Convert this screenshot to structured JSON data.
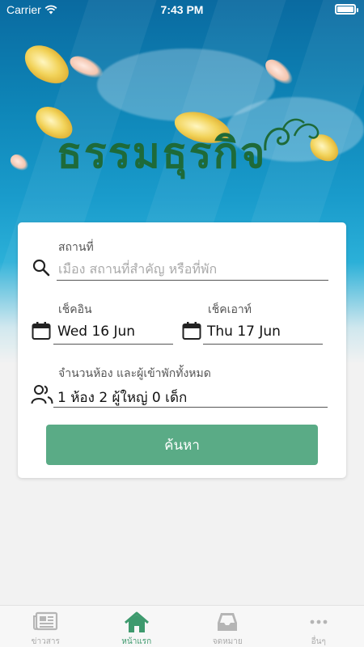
{
  "status": {
    "carrier": "Carrier",
    "time": "7:43 PM"
  },
  "brand": {
    "logo_text": "ธรรมธุรกิจ",
    "logo_color": "#1e6a39"
  },
  "search_form": {
    "location": {
      "label": "สถานที่",
      "placeholder": "เมือง สถานที่สำคัญ หรือที่พัก",
      "value": ""
    },
    "check_in": {
      "label": "เช็คอิน",
      "value": "Wed 16 Jun"
    },
    "check_out": {
      "label": "เช็คเอาท์",
      "value": "Thu 17 Jun"
    },
    "guests": {
      "label": "จำนวนห้อง และผู้เข้าพักทั้งหมด",
      "value": "1 ห้อง 2 ผู้ใหญ่ 0 เด็ก"
    },
    "submit_label": "ค้นหา",
    "accent_color": "#5aab86"
  },
  "tabbar": {
    "items": [
      {
        "label": "ข่าวสาร",
        "icon": "newspaper-icon"
      },
      {
        "label": "หน้าแรก",
        "icon": "home-icon",
        "active": true
      },
      {
        "label": "จดหมาย",
        "icon": "inbox-icon"
      },
      {
        "label": "อื่นๆ",
        "icon": "more-icon"
      }
    ],
    "active_color": "#3e9a6e",
    "inactive_color": "#aaaaaa"
  }
}
